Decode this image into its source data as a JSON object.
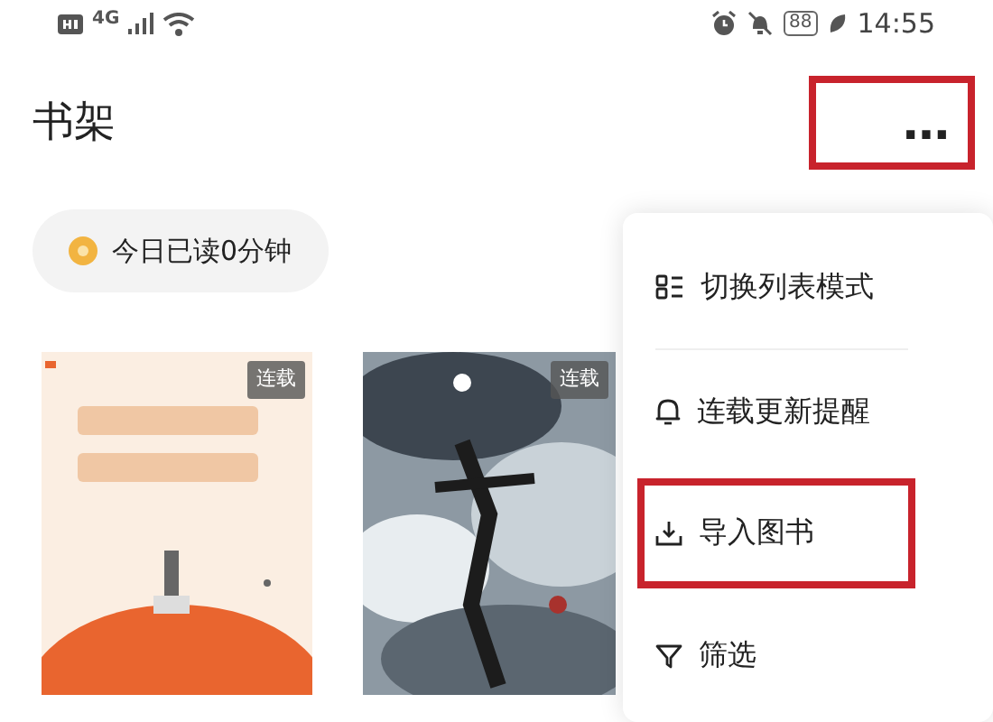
{
  "status_bar": {
    "network": "4G",
    "battery": "88",
    "time": "14:55"
  },
  "header": {
    "title": "书架",
    "more": {
      "label": "…",
      "highlighted": true
    }
  },
  "reading_chip": {
    "label": "今日已读0分钟"
  },
  "books": [
    {
      "badge": "连载"
    },
    {
      "badge": "连载"
    }
  ],
  "menu": [
    {
      "kind": "list",
      "label": "切换列表模式",
      "highlighted": false
    },
    {
      "kind": "bell",
      "label": "连载更新提醒",
      "highlighted": false
    },
    {
      "kind": "import",
      "label": "导入图书",
      "highlighted": true
    },
    {
      "kind": "filter",
      "label": "筛选",
      "highlighted": false
    }
  ]
}
